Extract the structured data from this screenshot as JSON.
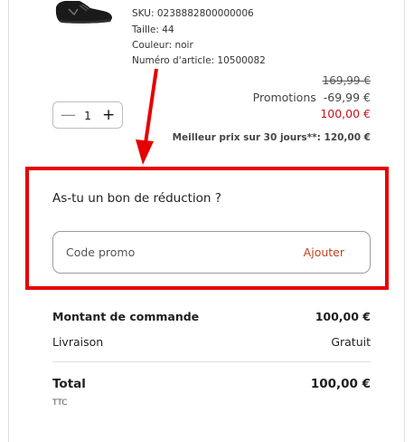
{
  "product": {
    "sku": "SKU: 0238882800000006",
    "size": "Taille: 44",
    "color": "Couleur: noir",
    "article_number": "Numéro d'article: 10500082",
    "quantity": "1",
    "quantity_minus": "—",
    "quantity_plus": "+",
    "old_price": "169,99 €",
    "promo_label": "Promotions",
    "promo_amount": "-69,99 €",
    "new_price": "100,00 €",
    "best_price": "Meilleur prix sur 30 jours**: 120,00 €"
  },
  "coupon": {
    "title": "As-tu un bon de réduction ?",
    "placeholder": "Code promo",
    "apply_label": "Ajouter"
  },
  "summary": {
    "order_amount_label": "Montant de commande",
    "order_amount_value": "100,00 €",
    "shipping_label": "Livraison",
    "shipping_value": "Gratuit",
    "total_label": "Total",
    "total_value": "100,00 €",
    "tax_note": "TTC"
  },
  "colors": {
    "annotation_red": "#e60000",
    "sale_price": "#c4161c",
    "apply_link": "#c0431a"
  }
}
